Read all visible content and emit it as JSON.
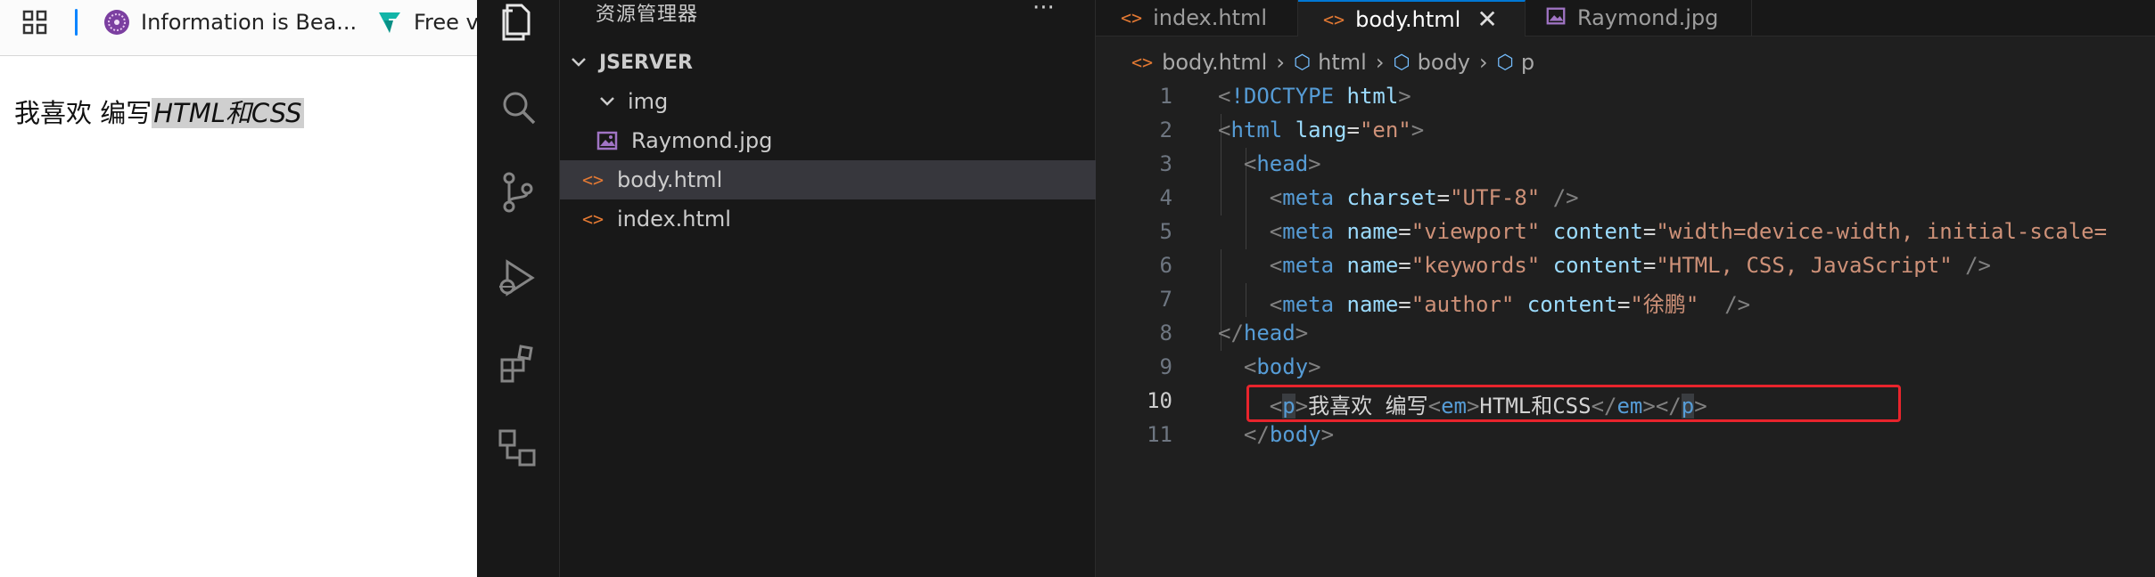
{
  "browser": {
    "bookmarks": [
      {
        "label": "Information is Bea...",
        "icon": "info-beautiful-icon"
      },
      {
        "label": "Free v",
        "icon": "vectorizer-icon"
      }
    ],
    "content": {
      "prefix": "我喜欢 编写",
      "emphasis": "HTML和CSS"
    }
  },
  "vscode": {
    "explorer": {
      "title": "资源管理器",
      "more": "···",
      "root": "JSERVER",
      "items": [
        {
          "label": "img",
          "type": "folder"
        },
        {
          "label": "Raymond.jpg",
          "type": "image"
        },
        {
          "label": "body.html",
          "type": "html"
        },
        {
          "label": "index.html",
          "type": "html"
        }
      ]
    },
    "tabs": [
      {
        "label": "index.html",
        "type": "html"
      },
      {
        "label": "body.html",
        "type": "html",
        "active": true,
        "close": "✕"
      },
      {
        "label": "Raymond.jpg",
        "type": "image"
      }
    ],
    "breadcrumb": [
      "body.html",
      "html",
      "body",
      "p"
    ],
    "line_numbers": [
      "1",
      "2",
      "3",
      "4",
      "5",
      "6",
      "7",
      "8",
      "9",
      "10",
      "11"
    ],
    "current_line": "10",
    "code": {
      "l1_doctype": "!DOCTYPE",
      "l1_html": "html",
      "l2_tag": "html",
      "l2_attr": "lang",
      "l2_val": "\"en\"",
      "l3_tag": "head",
      "meta": "meta",
      "l4_attr": "charset",
      "l4_val": "\"UTF-8\"",
      "name_attr": "name",
      "content_attr": "content",
      "l5_name": "\"viewport\"",
      "l5_content": "\"width=device-width, initial-scale=",
      "l6_name": "\"keywords\"",
      "l6_content": "\"HTML, CSS, JavaScript\"",
      "l7_name": "\"author\"",
      "l7_content": "\"徐鹏\"",
      "l8_tag": "head",
      "l9_tag": "body",
      "p_tag": "p",
      "em_tag": "em",
      "l10_text1": "我喜欢 编写",
      "l10_text2": "HTML和CSS",
      "l11_tag": "body"
    }
  },
  "colors": {
    "highlight_box": "#e8242c",
    "active_tab_border": "#0078d4",
    "html_icon": "#e37933"
  }
}
